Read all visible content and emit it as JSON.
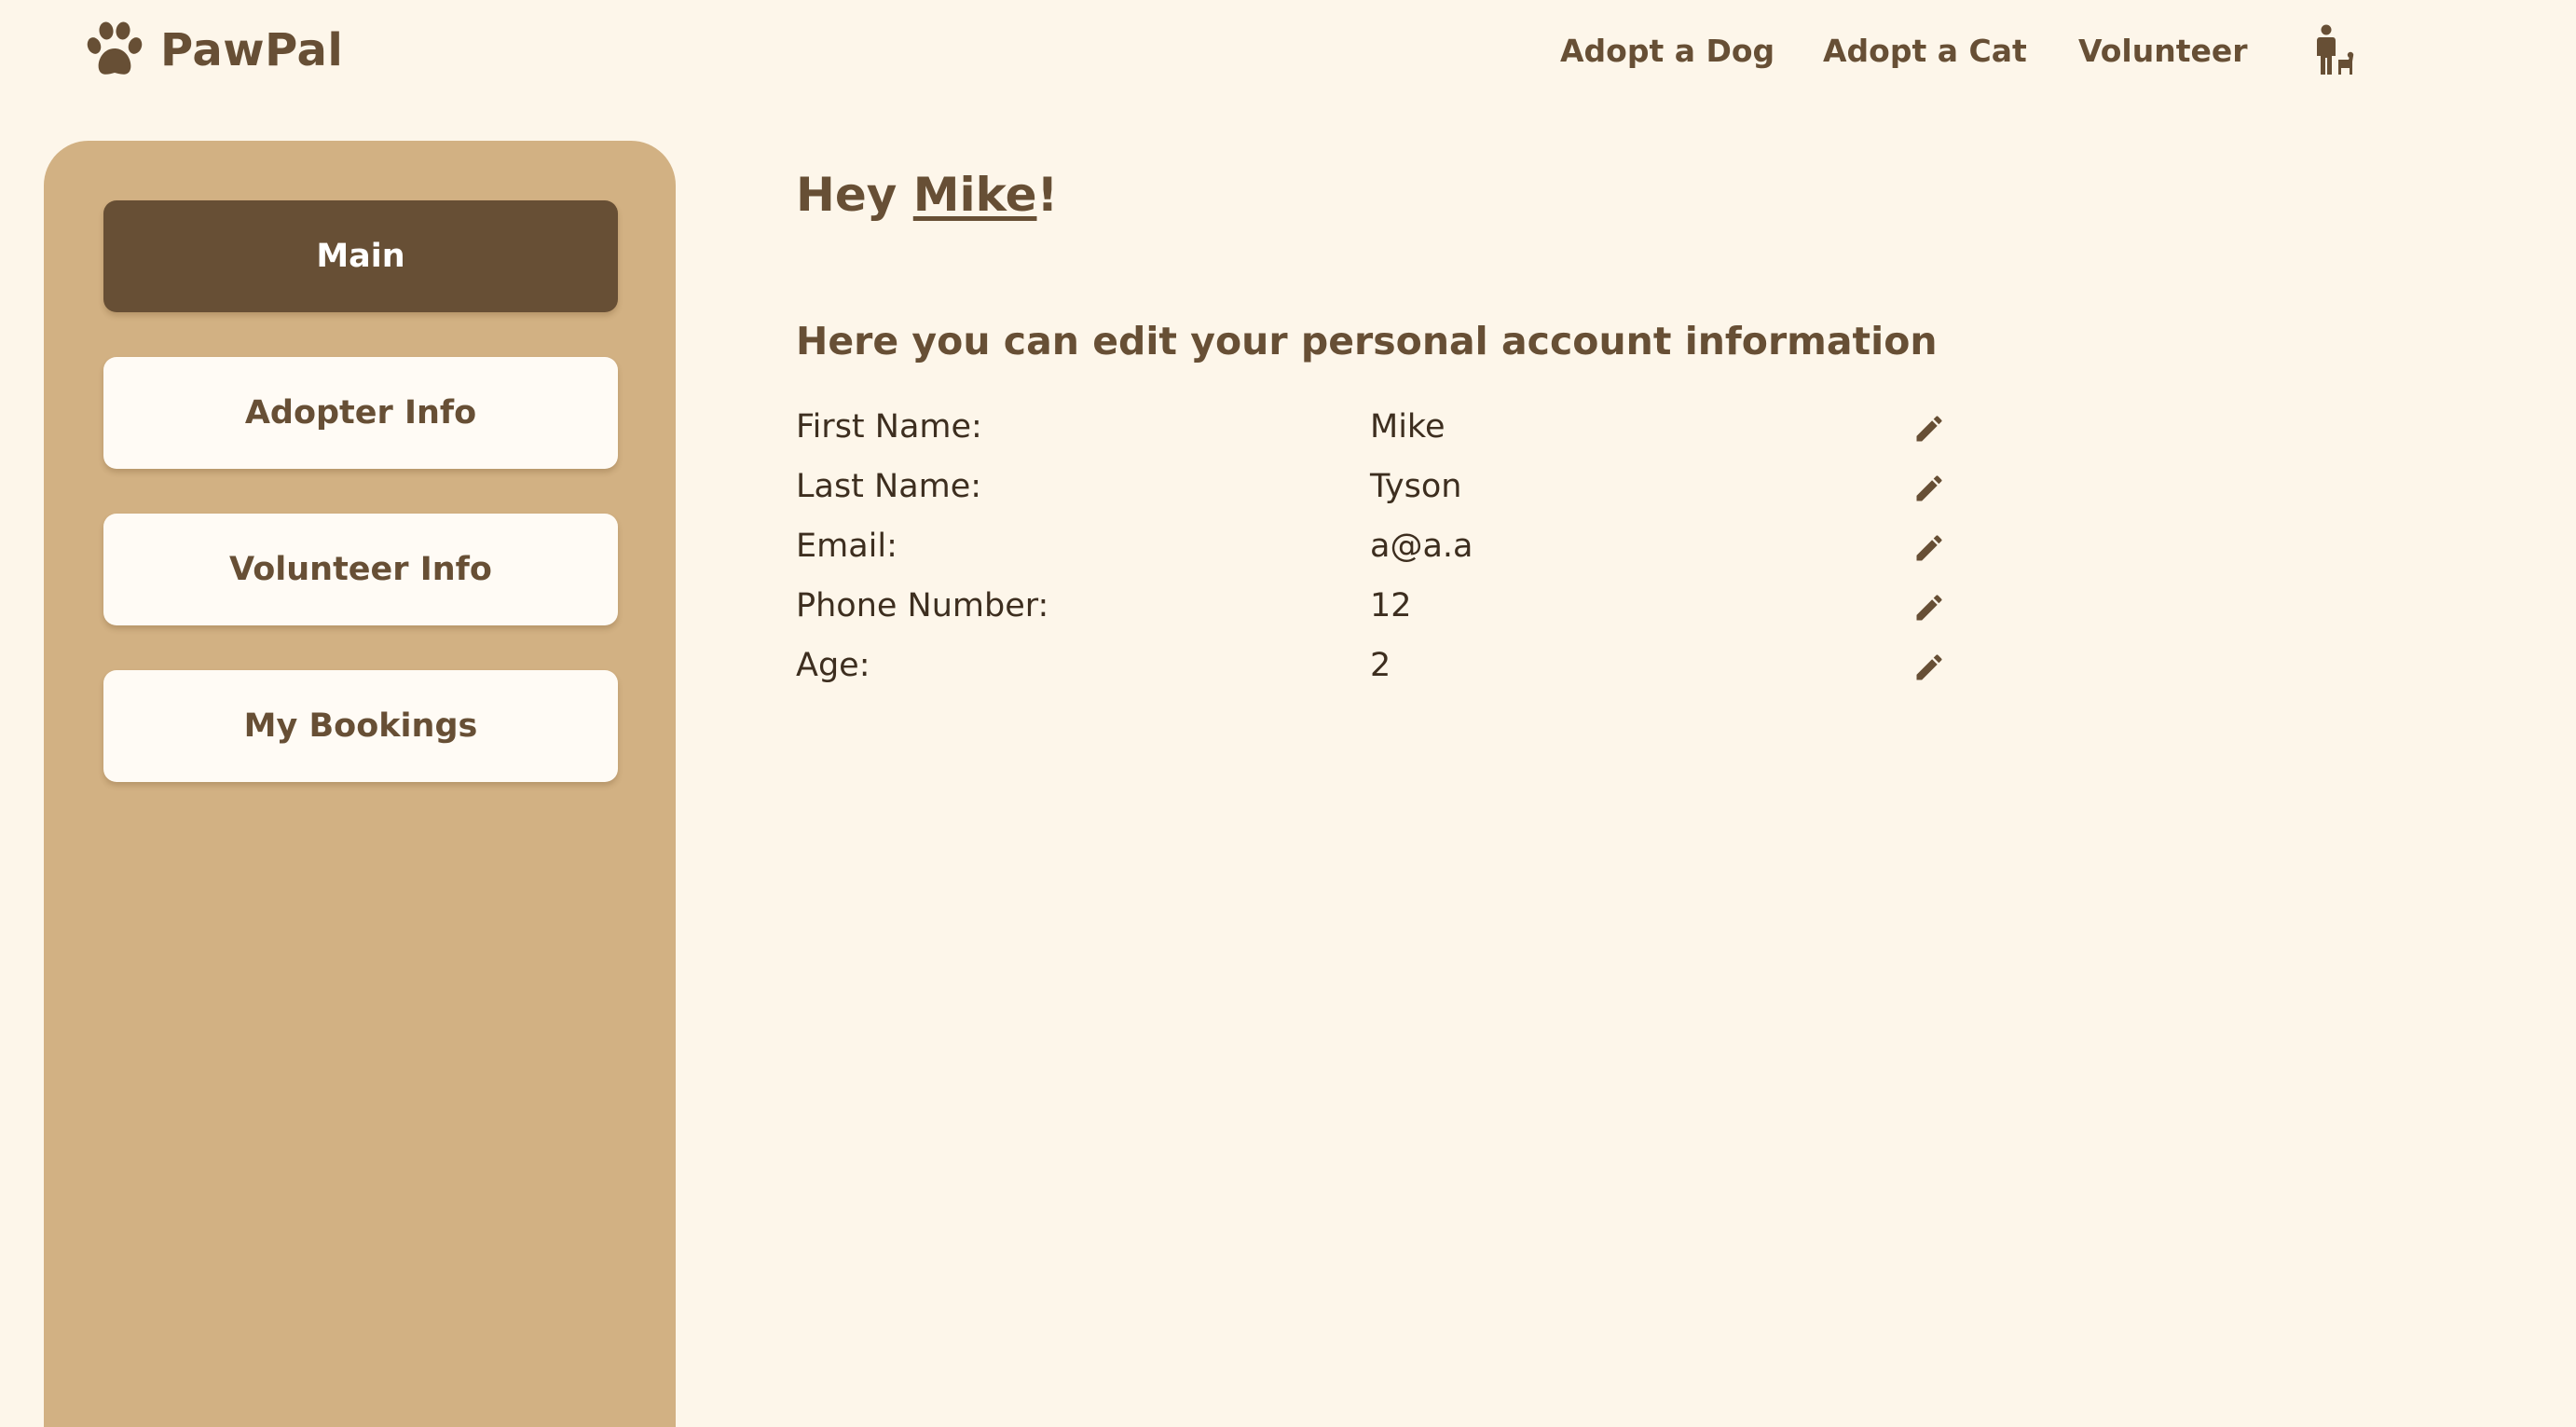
{
  "brand": {
    "name": "PawPal",
    "logo_icon": "paw-icon"
  },
  "nav": {
    "adopt_dog": "Adopt a Dog",
    "adopt_cat": "Adopt a Cat",
    "volunteer": "Volunteer",
    "profile_icon": "person-with-dog-icon"
  },
  "sidebar": {
    "items": [
      {
        "label": "Main",
        "active": true
      },
      {
        "label": "Adopter Info",
        "active": false
      },
      {
        "label": "Volunteer Info",
        "active": false
      },
      {
        "label": "My Bookings",
        "active": false
      }
    ]
  },
  "main": {
    "greeting_prefix": "Hey ",
    "user_name": "Mike",
    "greeting_suffix": "!",
    "subheading": "Here you can edit your personal account information",
    "fields": [
      {
        "label": "First Name:",
        "value": "Mike"
      },
      {
        "label": "Last Name:",
        "value": "Tyson"
      },
      {
        "label": "Email:",
        "value": "a@a.a"
      },
      {
        "label": "Phone Number:",
        "value": "12"
      },
      {
        "label": "Age:",
        "value": "2"
      }
    ],
    "edit_icon": "pencil-icon"
  },
  "colors": {
    "background": "#fdf6ea",
    "sidebar": "#d2b183",
    "accent": "#674f35",
    "button": "#fffbf5"
  }
}
